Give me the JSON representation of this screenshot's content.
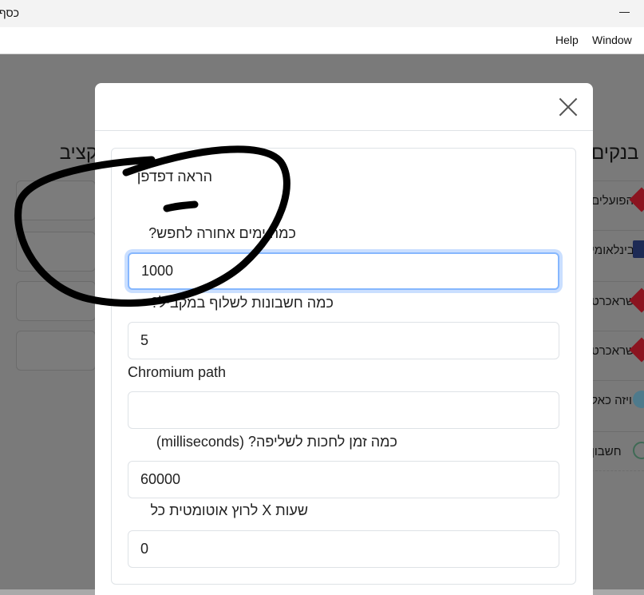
{
  "window": {
    "title": "כסף",
    "menu": [
      "Help",
      "Window"
    ]
  },
  "background": {
    "left_heading": "קציב",
    "right_heading": "בנקים",
    "banks": [
      "הפועלים",
      "הבינלאומי",
      "ישראכרט",
      "ישראכרט",
      "ויזה כאל",
      "חשבון"
    ]
  },
  "modal": {
    "close_label": "×",
    "show_browser_label": "הראה דפדפן",
    "show_browser_enabled": false,
    "days_back_label": "כמה ימים אחורה לחפש?",
    "days_back_value": "1000",
    "accounts_label": "כמה חשבונות לשלוף במקביל?",
    "accounts_value": "5",
    "chromium_label": "Chromium path",
    "chromium_value": "",
    "timeout_label": "כמה זמן לחכות לשליפה? (milliseconds)",
    "timeout_value": "60000",
    "auto_run_label": "שעות X לרוץ אוטומטית כל",
    "auto_run_value": "0"
  }
}
